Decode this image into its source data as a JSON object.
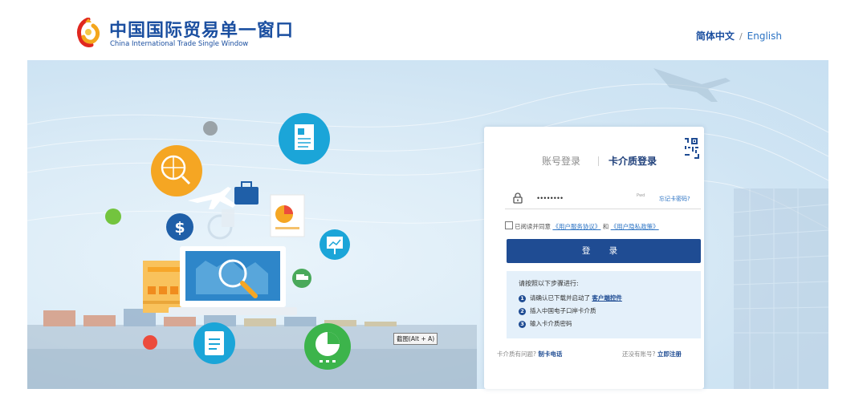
{
  "header": {
    "brand_cn": "中国国际贸易单一窗口",
    "brand_en": "China International Trade Single Window",
    "lang_current": "简体中文",
    "lang_sep": "/",
    "lang_alt": "English"
  },
  "banner": {
    "capture_tip": "截图(Alt + A)"
  },
  "login": {
    "tab_account": "账号登录",
    "tab_card": "卡介质登录",
    "password_value": "••••••••",
    "password_hint": "Pwd",
    "forgot": "忘记卡密码?",
    "agree_prefix": "已阅读并同意",
    "agree_service": "《用户服务协议》",
    "agree_and": "和",
    "agree_privacy": "《用户隐私政策》",
    "login_button": "登 录",
    "steps_title": "请按照以下步骤进行:",
    "step1_text": "请确认已下载并启动了",
    "step1_link": "客户端控件",
    "step2_text": "插入中国电子口岸卡介质",
    "step3_text": "输入卡介质密码",
    "foot_q": "卡介质有问题?",
    "foot_phone": "制卡电话",
    "foot_noacc": "还没有账号?",
    "foot_register": "立即注册"
  },
  "colors": {
    "brand": "#1b4fa0",
    "button": "#1f4c93",
    "link": "#2a72c3",
    "steps_bg": "#e4f0fa"
  }
}
